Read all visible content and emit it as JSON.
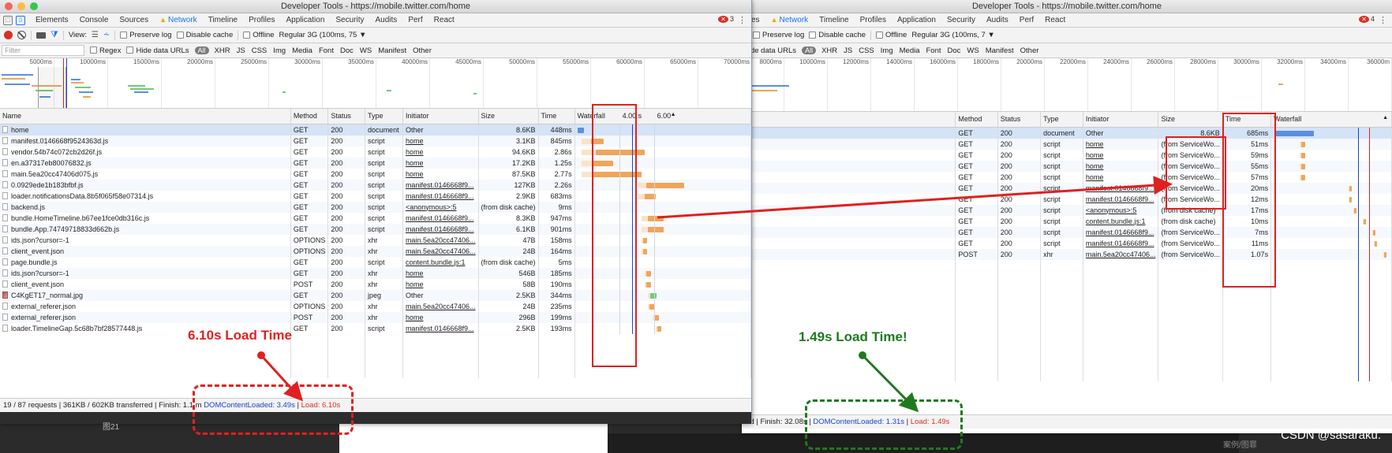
{
  "left": {
    "title": "Developer Tools - https://mobile.twitter.com/home",
    "tabs": [
      "Elements",
      "Console",
      "Sources",
      "Network",
      "Timeline",
      "Profiles",
      "Application",
      "Security",
      "Audits",
      "Perf",
      "React"
    ],
    "active_tab": "Network",
    "error_count": "3",
    "toolbar": {
      "view_label": "View:",
      "preserve_log": "Preserve log",
      "disable_cache": "Disable cache",
      "offline": "Offline",
      "throttle": "Regular 3G (100ms, 75",
      "throttle_arrow": "▼"
    },
    "filter": {
      "placeholder": "Filter",
      "regex": "Regex",
      "hide_data_urls": "Hide data URLs",
      "all": "All",
      "types": [
        "XHR",
        "JS",
        "CSS",
        "Img",
        "Media",
        "Font",
        "Doc",
        "WS",
        "Manifest",
        "Other"
      ]
    },
    "ticks": [
      "5000ms",
      "10000ms",
      "15000ms",
      "20000ms",
      "25000ms",
      "30000ms",
      "35000ms",
      "40000ms",
      "45000ms",
      "50000ms",
      "55000ms",
      "60000ms",
      "65000ms",
      "70000ms"
    ],
    "columns": [
      "Name",
      "Method",
      "Status",
      "Type",
      "Initiator",
      "Size",
      "Time",
      "Waterfall",
      "4.00 s",
      "6.00"
    ],
    "rows": [
      {
        "name": "home",
        "method": "GET",
        "status": "200",
        "type": "document",
        "initiator": "Other",
        "size": "8.6KB",
        "time": "448ms"
      },
      {
        "name": "manifest.0146668f9524363d.js",
        "method": "GET",
        "status": "200",
        "type": "script",
        "initiator": "home",
        "size": "3.1KB",
        "time": "845ms"
      },
      {
        "name": "vendor.54b74c072cb2d26f.js",
        "method": "GET",
        "status": "200",
        "type": "script",
        "initiator": "home",
        "size": "94.6KB",
        "time": "2.86s"
      },
      {
        "name": "en.a37317eb80076832.js",
        "method": "GET",
        "status": "200",
        "type": "script",
        "initiator": "home",
        "size": "17.2KB",
        "time": "1.25s"
      },
      {
        "name": "main.5ea20cc47406d075.js",
        "method": "GET",
        "status": "200",
        "type": "script",
        "initiator": "home",
        "size": "87.5KB",
        "time": "2.77s"
      },
      {
        "name": "0.0929ede1b183bfbf.js",
        "method": "GET",
        "status": "200",
        "type": "script",
        "initiator": "manifest.0146668f9...",
        "size": "127KB",
        "time": "2.26s"
      },
      {
        "name": "loader.notificationsData.8b5f065f58e07314.js",
        "method": "GET",
        "status": "200",
        "type": "script",
        "initiator": "manifest.0146668f9...",
        "size": "2.9KB",
        "time": "683ms"
      },
      {
        "name": "backend.js",
        "method": "GET",
        "status": "200",
        "type": "script",
        "initiator": "<anonymous>:5",
        "size": "(from disk cache)",
        "time": "9ms"
      },
      {
        "name": "bundle.HomeTimeline.b67ee1fce0db316c.js",
        "method": "GET",
        "status": "200",
        "type": "script",
        "initiator": "manifest.0146668f9...",
        "size": "8.3KB",
        "time": "947ms"
      },
      {
        "name": "bundle.App.74749718833d662b.js",
        "method": "GET",
        "status": "200",
        "type": "script",
        "initiator": "manifest.0146668f9...",
        "size": "6.1KB",
        "time": "901ms"
      },
      {
        "name": "ids.json?cursor=-1",
        "method": "OPTIONS",
        "status": "200",
        "type": "xhr",
        "initiator": "main.5ea20cc47406...",
        "size": "47B",
        "time": "158ms"
      },
      {
        "name": "client_event.json",
        "method": "OPTIONS",
        "status": "200",
        "type": "xhr",
        "initiator": "main.5ea20cc47406...",
        "size": "24B",
        "time": "164ms"
      },
      {
        "name": "page.bundle.js",
        "method": "GET",
        "status": "200",
        "type": "script",
        "initiator": "content.bundle.js:1",
        "size": "(from disk cache)",
        "time": "5ms"
      },
      {
        "name": "ids.json?cursor=-1",
        "method": "GET",
        "status": "200",
        "type": "xhr",
        "initiator": "home",
        "size": "546B",
        "time": "185ms"
      },
      {
        "name": "client_event.json",
        "method": "POST",
        "status": "200",
        "type": "xhr",
        "initiator": "home",
        "size": "58B",
        "time": "190ms"
      },
      {
        "name": "C4KgET17_normal.jpg",
        "method": "GET",
        "status": "200",
        "type": "jpeg",
        "initiator": "Other",
        "size": "2.5KB",
        "time": "344ms"
      },
      {
        "name": "external_referer.json",
        "method": "OPTIONS",
        "status": "200",
        "type": "xhr",
        "initiator": "main.5ea20cc47406...",
        "size": "24B",
        "time": "235ms"
      },
      {
        "name": "external_referer.json",
        "method": "POST",
        "status": "200",
        "type": "xhr",
        "initiator": "home",
        "size": "296B",
        "time": "199ms"
      },
      {
        "name": "loader.TimelineGap.5c68b7bf28577448.js",
        "method": "GET",
        "status": "200",
        "type": "script",
        "initiator": "manifest.0146668f9...",
        "size": "2.5KB",
        "time": "193ms"
      }
    ],
    "status": {
      "summary": "19 / 87 requests | 361KB / 602KB transferred | Finish: 1.1 m",
      "dom": "DOMContentLoaded: 3.49s",
      "sep": " | ",
      "load": "Load: 6.10s"
    },
    "annotation": "6.10s Load Time",
    "caption": "图21"
  },
  "right": {
    "title": "Developer Tools - https://mobile.twitter.com/home",
    "tabs": [
      "ces",
      "Network",
      "Timeline",
      "Profiles",
      "Application",
      "Security",
      "Audits",
      "Perf",
      "React"
    ],
    "active_tab": "Network",
    "error_count": "4",
    "toolbar": {
      "preserve_log": "Preserve log",
      "disable_cache": "Disable cache",
      "offline": "Offline",
      "throttle": "Regular 3G (100ms, 7",
      "throttle_arrow": "▼"
    },
    "filter": {
      "hide_data_urls": "Hide data URLs",
      "all": "All",
      "types": [
        "XHR",
        "JS",
        "CSS",
        "Img",
        "Media",
        "Font",
        "Doc",
        "WS",
        "Manifest",
        "Other"
      ]
    },
    "ticks": [
      "8000ms",
      "10000ms",
      "12000ms",
      "14000ms",
      "16000ms",
      "18000ms",
      "20000ms",
      "22000ms",
      "24000ms",
      "26000ms",
      "28000ms",
      "30000ms",
      "32000ms",
      "34000ms",
      "36000m"
    ],
    "columns": [
      "Method",
      "Status",
      "Type",
      "Initiator",
      "Size",
      "Time",
      "Waterfall"
    ],
    "rows": [
      {
        "method": "GET",
        "status": "200",
        "type": "document",
        "initiator": "Other",
        "size": "8.6KB",
        "time": "685ms"
      },
      {
        "method": "GET",
        "status": "200",
        "type": "script",
        "initiator": "home",
        "size": "(from ServiceWo...",
        "time": "51ms"
      },
      {
        "method": "GET",
        "status": "200",
        "type": "script",
        "initiator": "home",
        "size": "(from ServiceWo...",
        "time": "59ms"
      },
      {
        "method": "GET",
        "status": "200",
        "type": "script",
        "initiator": "home",
        "size": "(from ServiceWo...",
        "time": "55ms"
      },
      {
        "method": "GET",
        "status": "200",
        "type": "script",
        "initiator": "home",
        "size": "(from ServiceWo...",
        "time": "57ms"
      },
      {
        "method": "GET",
        "status": "200",
        "type": "script",
        "initiator": "manifest.0146668f9...",
        "size": "(from ServiceWo...",
        "time": "20ms"
      },
      {
        "method": "GET",
        "status": "200",
        "type": "script",
        "initiator": "manifest.0146668f9...",
        "size": "(from ServiceWo...",
        "time": "12ms"
      },
      {
        "method": "GET",
        "status": "200",
        "type": "script",
        "initiator": "<anonymous>:5",
        "size": "(from disk cache)",
        "time": "17ms"
      },
      {
        "method": "GET",
        "status": "200",
        "type": "script",
        "initiator": "content.bundle.js:1",
        "size": "(from disk cache)",
        "time": "10ms"
      },
      {
        "method": "GET",
        "status": "200",
        "type": "script",
        "initiator": "manifest.0146668f9...",
        "size": "(from ServiceWo...",
        "time": "7ms"
      },
      {
        "method": "GET",
        "status": "200",
        "type": "script",
        "initiator": "manifest.0146668f9...",
        "size": "(from ServiceWo...",
        "time": "11ms"
      },
      {
        "method": "POST",
        "status": "200",
        "type": "xhr",
        "initiator": "main.5ea20cc47406...",
        "size": "(from ServiceWo...",
        "time": "1.07s"
      }
    ],
    "status": {
      "summary": "red | Finish: 32.08s |",
      "dom": "DOMContentLoaded: 1.31s",
      "sep": " | ",
      "load": "Load: 1.49s"
    },
    "annotation": "1.49s Load Time!",
    "caption": "案例/图罪"
  },
  "watermark": "CSDN @sasaraku.",
  "colors": {
    "annotation_red": "#e02020",
    "annotation_green": "#1f7a1f",
    "active_tab": "#1a73e8",
    "dom_blue": "#1a45c8",
    "load_red": "#d93025",
    "waterfall_orange": "#f0a55a",
    "waterfall_blue": "#5b8fe0"
  }
}
